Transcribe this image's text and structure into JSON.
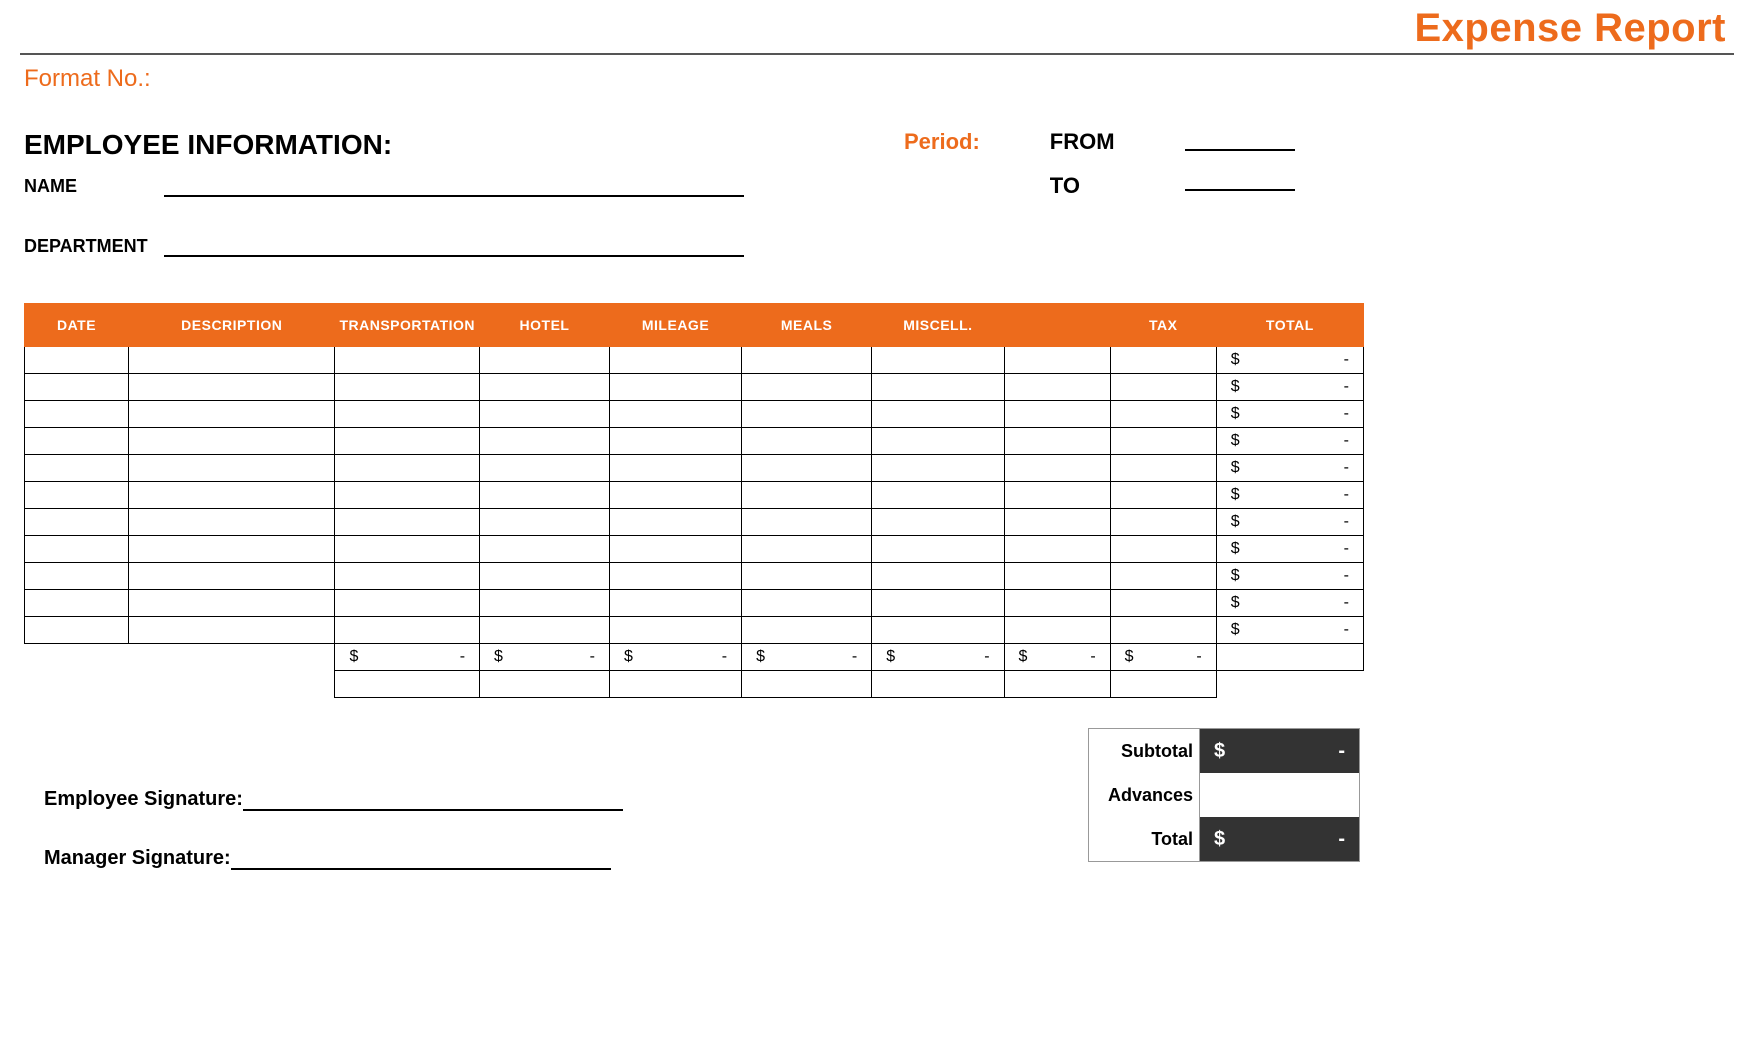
{
  "header": {
    "title": "Expense Report",
    "format_no_label": "Format No.:"
  },
  "employee": {
    "heading": "EMPLOYEE INFORMATION:",
    "name_label": "NAME",
    "dept_label": "DEPARTMENT"
  },
  "period": {
    "label": "Period:",
    "from_label": "FROM",
    "to_label": "TO"
  },
  "table": {
    "headers": {
      "date": "DATE",
      "description": "DESCRIPTION",
      "transportation": "TRANSPORTATION",
      "hotel": "HOTEL",
      "mileage": "MILEAGE",
      "meals": "MEALS",
      "misc": "MISCELL.",
      "blank": "",
      "tax": "TAX",
      "total": "TOTAL"
    },
    "rows": [
      {
        "total": "-"
      },
      {
        "total": "-"
      },
      {
        "total": "-"
      },
      {
        "total": "-"
      },
      {
        "total": "-"
      },
      {
        "total": "-"
      },
      {
        "total": "-"
      },
      {
        "total": "-"
      },
      {
        "total": "-"
      },
      {
        "total": "-"
      },
      {
        "total": "-"
      }
    ],
    "column_sums": {
      "transportation": "-",
      "hotel": "-",
      "mileage": "-",
      "meals": "-",
      "misc": "-",
      "blank": "-",
      "tax": "-"
    },
    "currency": "$"
  },
  "totals": {
    "subtotal_label": "Subtotal",
    "subtotal_value": "-",
    "advances_label": "Advances",
    "advances_value": "",
    "total_label": "Total",
    "total_value": "-"
  },
  "signatures": {
    "employee": "Employee Signature:",
    "manager": "Manager Signature:"
  }
}
